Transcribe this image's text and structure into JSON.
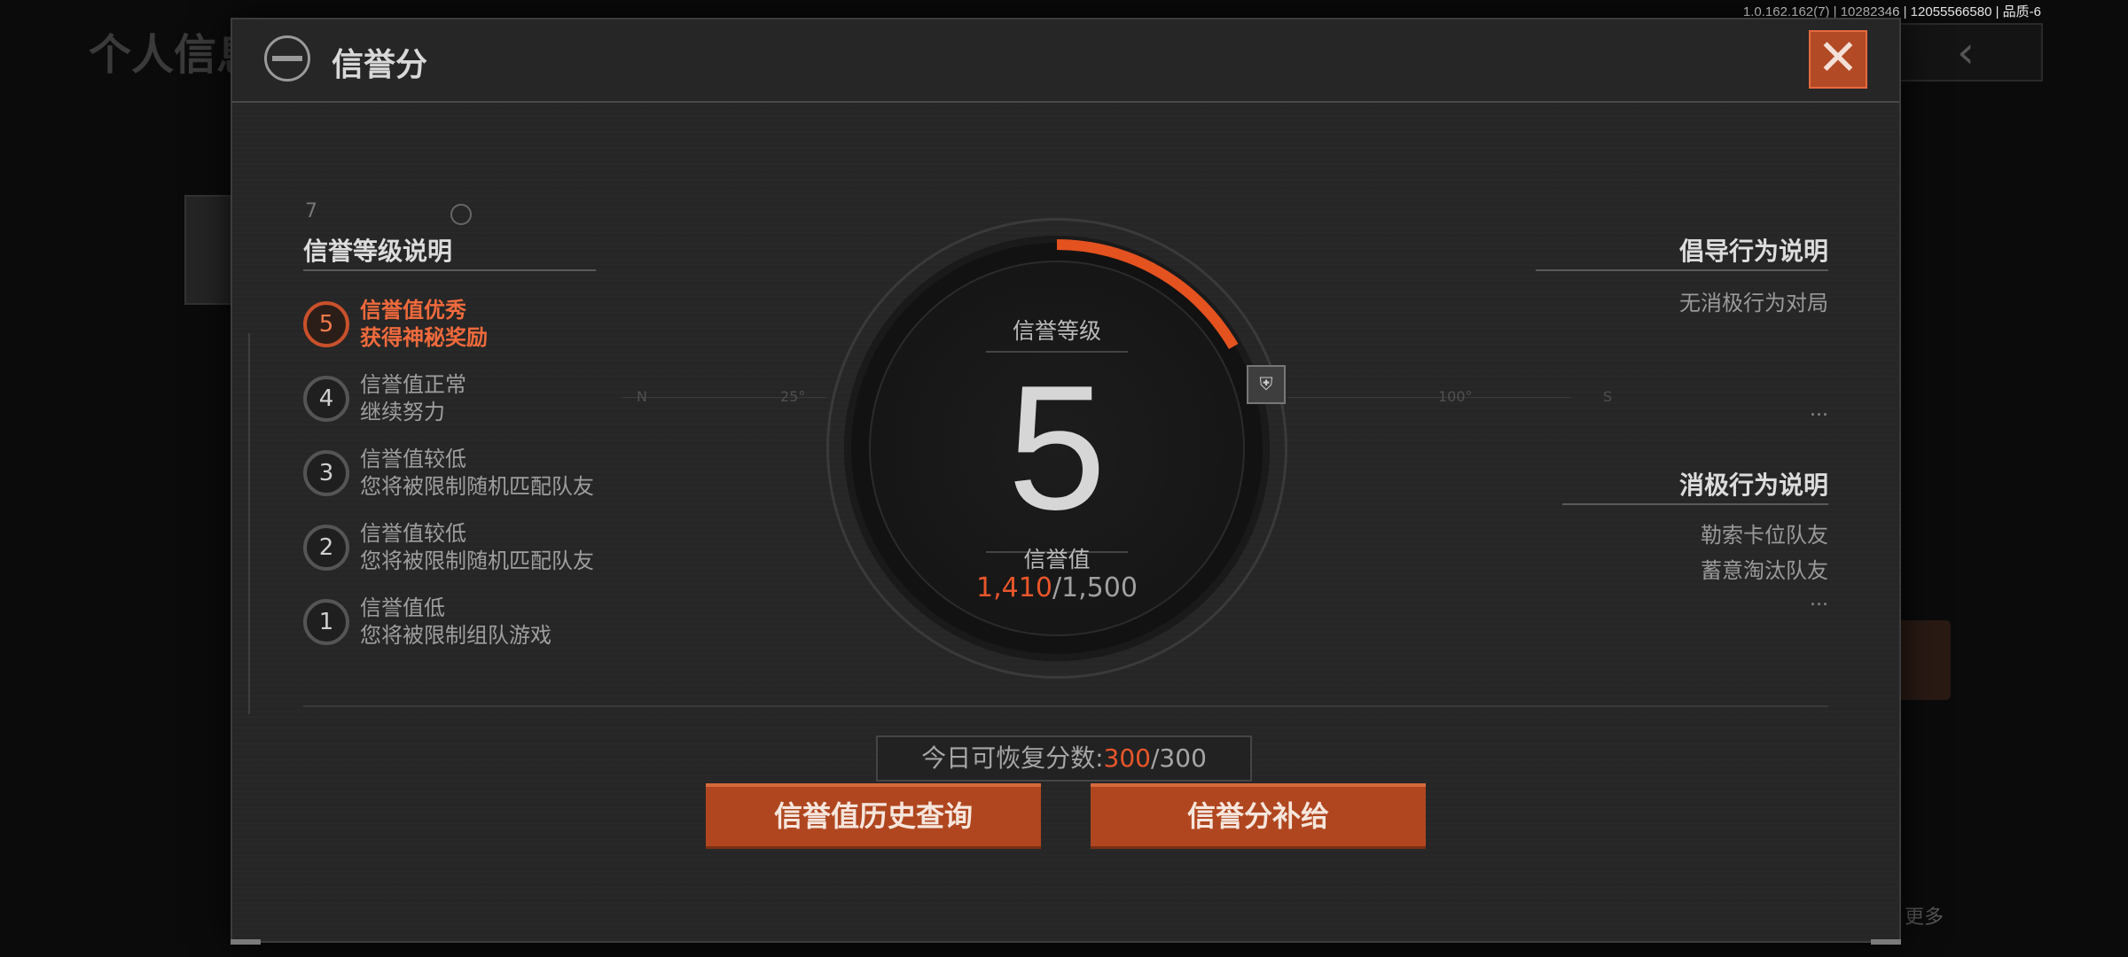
{
  "version_info": "1.0.162.162(7) | 10282346 | 12055566580 | 品质-6",
  "background": {
    "title": "个人信息",
    "back_glyph": "‹",
    "more_label": "更多"
  },
  "modal": {
    "title": "信誉分",
    "close_glyph": "✕"
  },
  "left": {
    "corner_num": "7",
    "section_title": "信誉等级说明",
    "levels": [
      {
        "num": "5",
        "line1": "信誉值优秀",
        "line2": "获得神秘奖励",
        "active": true
      },
      {
        "num": "4",
        "line1": "信誉值正常",
        "line2": "继续努力",
        "active": false
      },
      {
        "num": "3",
        "line1": "信誉值较低",
        "line2": "您将被限制随机匹配队友",
        "active": false
      },
      {
        "num": "2",
        "line1": "信誉值较低",
        "line2": "您将被限制随机匹配队友",
        "active": false
      },
      {
        "num": "1",
        "line1": "信誉值低",
        "line2": "您将被限制组队游戏",
        "active": false
      }
    ]
  },
  "gauge": {
    "level_label": "信誉等级",
    "level_value": "5",
    "score_label": "信誉值",
    "score_current": "1,410",
    "score_max": "/1,500",
    "progress": 0.94,
    "compass": [
      "N",
      "25°",
      "100°",
      "S"
    ]
  },
  "right": {
    "guide_title": "倡导行为说明",
    "guide_items": [
      "无消极行为对局"
    ],
    "guide_more": "...",
    "negative_title": "消极行为说明",
    "negative_items": [
      "勒索卡位队友",
      "蓄意淘汰队友"
    ],
    "negative_more": "..."
  },
  "recover": {
    "label": "今日可恢复分数:",
    "current": "300",
    "max": "/300"
  },
  "buttons": {
    "history": "信誉值历史查询",
    "supply": "信誉分补给"
  },
  "colors": {
    "accent": "#e9562a",
    "button": "#b0461f",
    "panel": "#262626"
  }
}
